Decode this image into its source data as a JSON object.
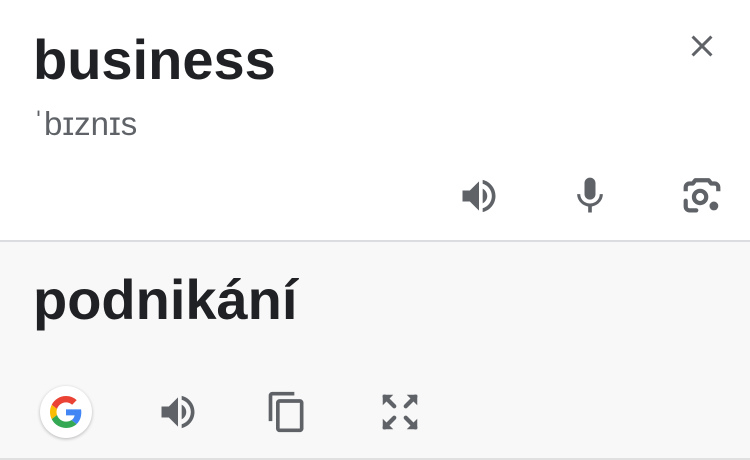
{
  "source": {
    "text": "business",
    "phonetic": "ˈbɪznɪs",
    "close_icon": "close-icon",
    "actions": [
      "speaker-icon",
      "microphone-icon",
      "lens-camera-icon"
    ]
  },
  "target": {
    "text": "podnikání",
    "actions": [
      "google-logo-icon",
      "speaker-icon",
      "copy-icon",
      "fullscreen-icon"
    ]
  },
  "colors": {
    "icon": "#5f6368",
    "text": "#202124",
    "phonetic": "#5f6368",
    "target_background": "#f8f8f8",
    "divider": "#dadce0",
    "google_blue": "#4285F4",
    "google_red": "#EA4335",
    "google_yellow": "#FBBC05",
    "google_green": "#34A853"
  }
}
